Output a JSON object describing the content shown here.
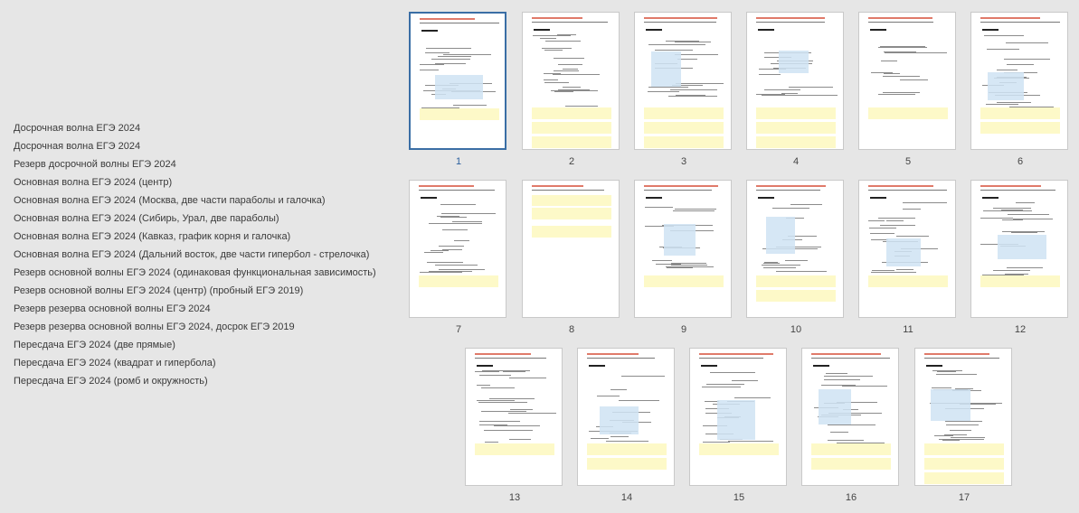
{
  "toc": [
    "Досрочная волна ЕГЭ 2024",
    "Досрочная волна ЕГЭ 2024",
    "Резерв досрочной волны ЕГЭ 2024",
    "Основная волна ЕГЭ 2024 (центр)",
    "Основная волна ЕГЭ 2024 (Москва, две части параболы и галочка)",
    "Основная волна ЕГЭ 2024 (Сибирь, Урал, две параболы)",
    "Основная волна ЕГЭ 2024 (Кавказ, график корня и галочка)",
    "Основная волна ЕГЭ 2024 (Дальний восток, две части гипербол - стрелочка)",
    "Резерв основной волны ЕГЭ 2024 (одинаковая функциональная зависимость)",
    "Резерв основной волны ЕГЭ 2024 (центр) (пробный ЕГЭ 2019)",
    "Резерв резерва основной волны ЕГЭ 2024",
    "Резерв резерва основной волны ЕГЭ 2024, досрок ЕГЭ 2019",
    "Пересдача ЕГЭ 2024 (две прямые)",
    "Пересдача ЕГЭ 2024 (квадрат и гипербола)",
    "Пересдача ЕГЭ 2024 (ромб и окружность)"
  ],
  "pages": [
    {
      "number": "1",
      "selected": true
    },
    {
      "number": "2",
      "selected": false
    },
    {
      "number": "3",
      "selected": false
    },
    {
      "number": "4",
      "selected": false
    },
    {
      "number": "5",
      "selected": false
    },
    {
      "number": "6",
      "selected": false
    },
    {
      "number": "7",
      "selected": false
    },
    {
      "number": "8",
      "selected": false
    },
    {
      "number": "9",
      "selected": false
    },
    {
      "number": "10",
      "selected": false
    },
    {
      "number": "11",
      "selected": false
    },
    {
      "number": "12",
      "selected": false
    },
    {
      "number": "13",
      "selected": false
    },
    {
      "number": "14",
      "selected": false
    },
    {
      "number": "15",
      "selected": false
    },
    {
      "number": "16",
      "selected": false
    },
    {
      "number": "17",
      "selected": false
    }
  ],
  "colors": {
    "background": "#e6e6e6",
    "selection": "#3a6ea5",
    "highlight": "#fdf9c8",
    "blue_fill": "#cfe3f3",
    "title_red": "#e07a6a"
  }
}
